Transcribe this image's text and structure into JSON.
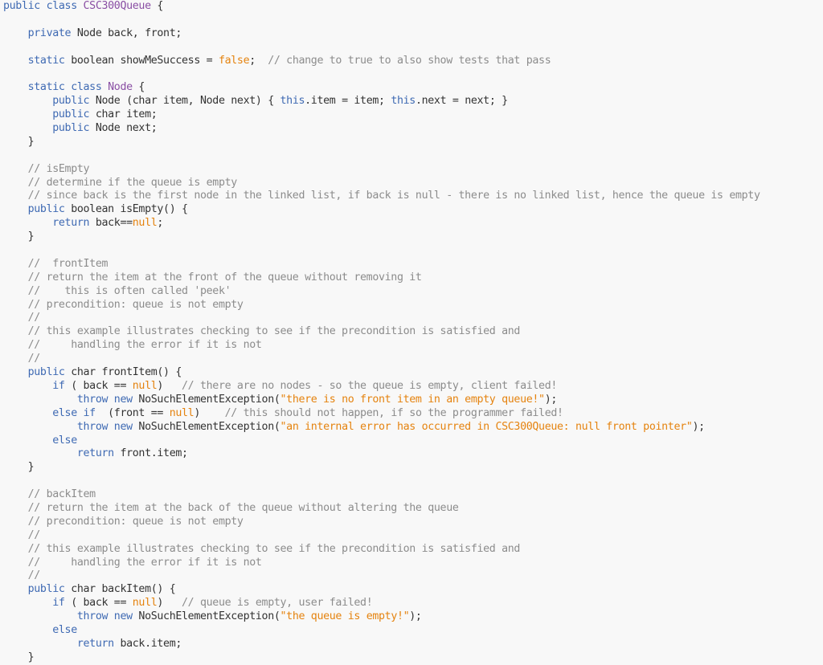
{
  "colors": {
    "background": "#f8f8f8",
    "keyword": "#3f6ab3",
    "class_name": "#8a4fa4",
    "literal": "#e5830f",
    "comment": "#8c8c8c",
    "text": "#333333"
  },
  "code_lines": [
    [
      {
        "t": "kw",
        "v": "public class "
      },
      {
        "t": "cls",
        "v": "CSC300Queue"
      },
      {
        "t": "plain",
        "v": " {"
      }
    ],
    [],
    [
      {
        "t": "plain",
        "v": "    "
      },
      {
        "t": "kw",
        "v": "private"
      },
      {
        "t": "plain",
        "v": " Node back, front;"
      }
    ],
    [],
    [
      {
        "t": "plain",
        "v": "    "
      },
      {
        "t": "kw",
        "v": "static"
      },
      {
        "t": "plain",
        "v": " boolean showMeSuccess = "
      },
      {
        "t": "lit",
        "v": "false"
      },
      {
        "t": "plain",
        "v": ";  "
      },
      {
        "t": "cm",
        "v": "// change to true to also show tests that pass"
      }
    ],
    [],
    [
      {
        "t": "plain",
        "v": "    "
      },
      {
        "t": "kw",
        "v": "static class "
      },
      {
        "t": "cls",
        "v": "Node"
      },
      {
        "t": "plain",
        "v": " {"
      }
    ],
    [
      {
        "t": "plain",
        "v": "        "
      },
      {
        "t": "kw",
        "v": "public"
      },
      {
        "t": "plain",
        "v": " Node (char item, Node next) { "
      },
      {
        "t": "kw",
        "v": "this"
      },
      {
        "t": "plain",
        "v": ".item = item; "
      },
      {
        "t": "kw",
        "v": "this"
      },
      {
        "t": "plain",
        "v": ".next = next; }"
      }
    ],
    [
      {
        "t": "plain",
        "v": "        "
      },
      {
        "t": "kw",
        "v": "public"
      },
      {
        "t": "plain",
        "v": " char item;"
      }
    ],
    [
      {
        "t": "plain",
        "v": "        "
      },
      {
        "t": "kw",
        "v": "public"
      },
      {
        "t": "plain",
        "v": " Node next;"
      }
    ],
    [
      {
        "t": "plain",
        "v": "    }"
      }
    ],
    [],
    [
      {
        "t": "plain",
        "v": "    "
      },
      {
        "t": "cm",
        "v": "// isEmpty"
      }
    ],
    [
      {
        "t": "plain",
        "v": "    "
      },
      {
        "t": "cm",
        "v": "// determine if the queue is empty"
      }
    ],
    [
      {
        "t": "plain",
        "v": "    "
      },
      {
        "t": "cm",
        "v": "// since back is the first node in the linked list, if back is null - there is no linked list, hence the queue is empty"
      }
    ],
    [
      {
        "t": "plain",
        "v": "    "
      },
      {
        "t": "kw",
        "v": "public"
      },
      {
        "t": "plain",
        "v": " boolean isEmpty() {"
      }
    ],
    [
      {
        "t": "plain",
        "v": "        "
      },
      {
        "t": "kw",
        "v": "return"
      },
      {
        "t": "plain",
        "v": " back=="
      },
      {
        "t": "lit",
        "v": "null"
      },
      {
        "t": "plain",
        "v": ";"
      }
    ],
    [
      {
        "t": "plain",
        "v": "    }"
      }
    ],
    [],
    [
      {
        "t": "plain",
        "v": "    "
      },
      {
        "t": "cm",
        "v": "//  frontItem"
      }
    ],
    [
      {
        "t": "plain",
        "v": "    "
      },
      {
        "t": "cm",
        "v": "// return the item at the front of the queue without removing it"
      }
    ],
    [
      {
        "t": "plain",
        "v": "    "
      },
      {
        "t": "cm",
        "v": "//    this is often called 'peek'"
      }
    ],
    [
      {
        "t": "plain",
        "v": "    "
      },
      {
        "t": "cm",
        "v": "// precondition: queue is not empty"
      }
    ],
    [
      {
        "t": "plain",
        "v": "    "
      },
      {
        "t": "cm",
        "v": "//"
      }
    ],
    [
      {
        "t": "plain",
        "v": "    "
      },
      {
        "t": "cm",
        "v": "// this example illustrates checking to see if the precondition is satisfied and"
      }
    ],
    [
      {
        "t": "plain",
        "v": "    "
      },
      {
        "t": "cm",
        "v": "//     handling the error if it is not"
      }
    ],
    [
      {
        "t": "plain",
        "v": "    "
      },
      {
        "t": "cm",
        "v": "//"
      }
    ],
    [
      {
        "t": "plain",
        "v": "    "
      },
      {
        "t": "kw",
        "v": "public"
      },
      {
        "t": "plain",
        "v": " char frontItem() {"
      }
    ],
    [
      {
        "t": "plain",
        "v": "        "
      },
      {
        "t": "kw",
        "v": "if"
      },
      {
        "t": "plain",
        "v": " ( back == "
      },
      {
        "t": "lit",
        "v": "null"
      },
      {
        "t": "plain",
        "v": ")   "
      },
      {
        "t": "cm",
        "v": "// there are no nodes - so the queue is empty, client failed!"
      }
    ],
    [
      {
        "t": "plain",
        "v": "            "
      },
      {
        "t": "kw",
        "v": "throw new"
      },
      {
        "t": "plain",
        "v": " NoSuchElementException("
      },
      {
        "t": "str",
        "v": "\"there is no front item in an empty queue!\""
      },
      {
        "t": "plain",
        "v": ");"
      }
    ],
    [
      {
        "t": "plain",
        "v": "        "
      },
      {
        "t": "kw",
        "v": "else if"
      },
      {
        "t": "plain",
        "v": "  (front == "
      },
      {
        "t": "lit",
        "v": "null"
      },
      {
        "t": "plain",
        "v": ")    "
      },
      {
        "t": "cm",
        "v": "// this should not happen, if so the programmer failed!"
      }
    ],
    [
      {
        "t": "plain",
        "v": "            "
      },
      {
        "t": "kw",
        "v": "throw new"
      },
      {
        "t": "plain",
        "v": " NoSuchElementException("
      },
      {
        "t": "str",
        "v": "\"an internal error has occurred in CSC300Queue: null front pointer\""
      },
      {
        "t": "plain",
        "v": ");"
      }
    ],
    [
      {
        "t": "plain",
        "v": "        "
      },
      {
        "t": "kw",
        "v": "else"
      }
    ],
    [
      {
        "t": "plain",
        "v": "            "
      },
      {
        "t": "kw",
        "v": "return"
      },
      {
        "t": "plain",
        "v": " front.item;"
      }
    ],
    [
      {
        "t": "plain",
        "v": "    }"
      }
    ],
    [],
    [
      {
        "t": "plain",
        "v": "    "
      },
      {
        "t": "cm",
        "v": "// backItem"
      }
    ],
    [
      {
        "t": "plain",
        "v": "    "
      },
      {
        "t": "cm",
        "v": "// return the item at the back of the queue without altering the queue"
      }
    ],
    [
      {
        "t": "plain",
        "v": "    "
      },
      {
        "t": "cm",
        "v": "// precondition: queue is not empty"
      }
    ],
    [
      {
        "t": "plain",
        "v": "    "
      },
      {
        "t": "cm",
        "v": "//"
      }
    ],
    [
      {
        "t": "plain",
        "v": "    "
      },
      {
        "t": "cm",
        "v": "// this example illustrates checking to see if the precondition is satisfied and"
      }
    ],
    [
      {
        "t": "plain",
        "v": "    "
      },
      {
        "t": "cm",
        "v": "//     handling the error if it is not"
      }
    ],
    [
      {
        "t": "plain",
        "v": "    "
      },
      {
        "t": "cm",
        "v": "//"
      }
    ],
    [
      {
        "t": "plain",
        "v": "    "
      },
      {
        "t": "kw",
        "v": "public"
      },
      {
        "t": "plain",
        "v": " char backItem() {"
      }
    ],
    [
      {
        "t": "plain",
        "v": "        "
      },
      {
        "t": "kw",
        "v": "if"
      },
      {
        "t": "plain",
        "v": " ( back == "
      },
      {
        "t": "lit",
        "v": "null"
      },
      {
        "t": "plain",
        "v": ")   "
      },
      {
        "t": "cm",
        "v": "// queue is empty, user failed!"
      }
    ],
    [
      {
        "t": "plain",
        "v": "            "
      },
      {
        "t": "kw",
        "v": "throw new"
      },
      {
        "t": "plain",
        "v": " NoSuchElementException("
      },
      {
        "t": "str",
        "v": "\"the queue is empty!\""
      },
      {
        "t": "plain",
        "v": ");"
      }
    ],
    [
      {
        "t": "plain",
        "v": "        "
      },
      {
        "t": "kw",
        "v": "else"
      }
    ],
    [
      {
        "t": "plain",
        "v": "            "
      },
      {
        "t": "kw",
        "v": "return"
      },
      {
        "t": "plain",
        "v": " back.item;"
      }
    ],
    [
      {
        "t": "plain",
        "v": "    }"
      }
    ]
  ]
}
